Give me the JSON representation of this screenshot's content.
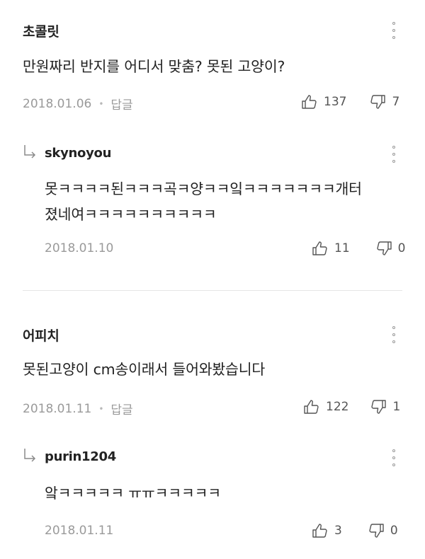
{
  "comments": [
    {
      "author": "초콜릿",
      "text": "만원짜리 반지를 어디서 맞춤? 못된 고양이?",
      "date": "2018.01.06",
      "reply_label": "답글",
      "likes": "137",
      "dislikes": "7",
      "replies": [
        {
          "author": "skynoyou",
          "text_line1": "못ㅋㅋㅋㅋ된ㅋㅋㅋ곡ㅋ양ㅋㅋ잌ㅋㅋㅋㅋㅋㅋㅋ개터",
          "text_line2": "졌네여ㅋㅋㅋㅋㅋㅋㅋㅋㅋㅋ",
          "date": "2018.01.10",
          "likes": "11",
          "dislikes": "0"
        }
      ]
    },
    {
      "author": "어피치",
      "text": "못된고양이 cm송이래서 들어와봤습니다",
      "date": "2018.01.11",
      "reply_label": "답글",
      "likes": "122",
      "dislikes": "1",
      "replies": [
        {
          "author": "purin1204",
          "text_line1": "앜ㅋㅋㅋㅋㅋ ㅠㅠㅋㅋㅋㅋㅋ",
          "date": "2018.01.11",
          "likes": "3",
          "dislikes": "0"
        }
      ]
    }
  ]
}
